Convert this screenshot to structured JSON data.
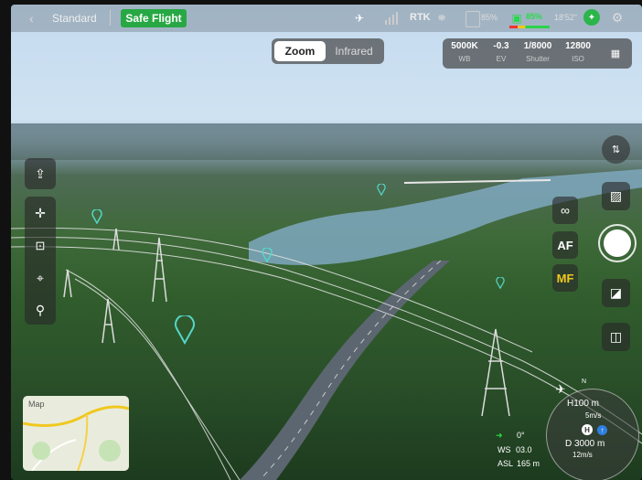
{
  "topbar": {
    "mode_label": "Standard",
    "safe_flight_label": "Safe Flight",
    "rtk_label": "RTK",
    "battery_text": "85%",
    "remaining_time": "18'52\""
  },
  "view_toggle": {
    "zoom_label": "Zoom",
    "infrared_label": "Infrared"
  },
  "camera_params": [
    {
      "value": "5000K",
      "label": "WB"
    },
    {
      "value": "-0.3",
      "label": "EV"
    },
    {
      "value": "1/8000",
      "label": "Shutter"
    },
    {
      "value": "12800",
      "label": "ISO"
    }
  ],
  "focus": {
    "af_label": "AF",
    "mf_label": "MF"
  },
  "map": {
    "label": "Map"
  },
  "telemetry": {
    "heading": "0°",
    "ws_label": "WS",
    "ws_value": "03.0",
    "asl_label": "ASL",
    "asl_value": "165 m",
    "h_value": "H100 m",
    "vs_value": "5m/s",
    "d_value": "D 3000 m",
    "hs_value": "12m/s",
    "north_label": "N"
  },
  "colors": {
    "safe_flight": "#27a844",
    "accent_yellow": "#f0c81e",
    "waypoint": "#54d6c8"
  }
}
